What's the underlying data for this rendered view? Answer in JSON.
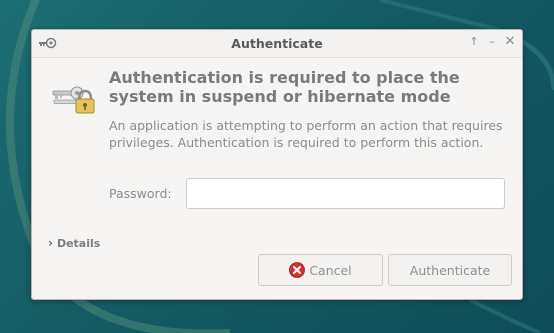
{
  "window": {
    "title": "Authenticate",
    "controls": {
      "maximize": "↑",
      "minimize": "–",
      "close": "✕"
    }
  },
  "dialog": {
    "heading": "Authentication is required to place the system in suspend or hibernate mode",
    "description": "An application is attempting to perform an action that requires privileges. Authentication is required to perform this action.",
    "password_label": "Password:",
    "password_value": "",
    "details_label": "Details",
    "cancel_label": "Cancel",
    "authenticate_label": "Authenticate"
  },
  "icons": {
    "title": "keys-icon",
    "main": "keys-lock-icon",
    "details": "chevron-right-icon",
    "cancel": "cancel-icon"
  },
  "colors": {
    "desktop": "#145b63",
    "dialog_bg": "#f6f5f4",
    "cancel_red": "#d42f2f"
  }
}
